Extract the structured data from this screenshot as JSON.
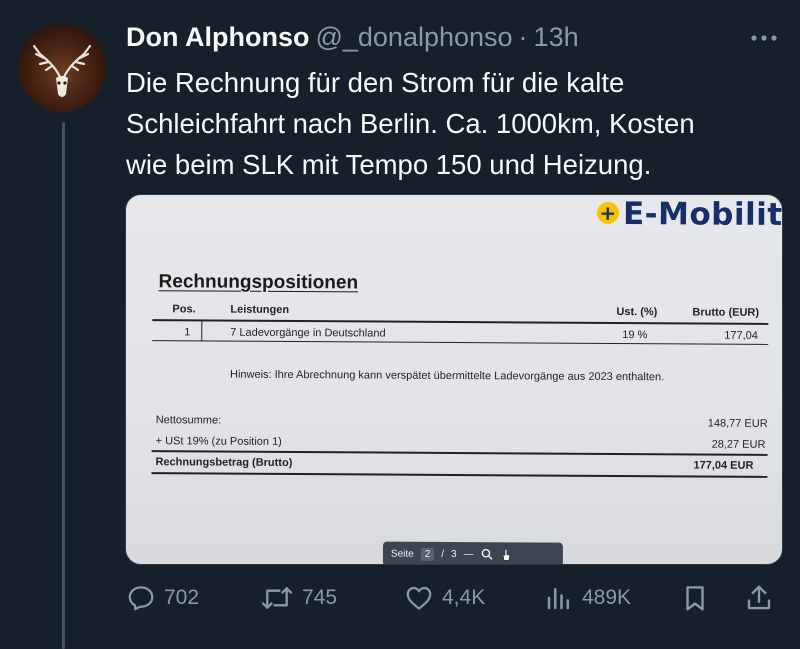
{
  "tweet": {
    "display_name": "Don Alphonso",
    "handle": "@_donalphonso",
    "separator": "·",
    "time": "13h",
    "text": "Die Rechnung für den Strom für die kalte\nSchleichfahrt nach Berlin. Ca. 1000km, Kosten\nwie beim SLK mit Tempo 150 und Heizung."
  },
  "media": {
    "brand": "E-Mobilitat",
    "heading": "Rechnungspositionen",
    "columns": {
      "pos": "Pos.",
      "leistungen": "Leistungen",
      "ust": "Ust. (%)",
      "brutto": "Brutto (EUR)"
    },
    "line_item": {
      "pos": "1",
      "leistung": "7 Ladevorgänge in Deutschland",
      "ust": "19 %",
      "brutto": "177,04"
    },
    "hint": "Hinweis: Ihre Abrechnung kann verspätet übermittelte Ladevorgänge aus 2023 enthalten.",
    "net_label": "Nettosumme:",
    "net_value": "148,77 EUR",
    "tax_label": "+ USt 19% (zu Position 1)",
    "tax_value": "28,27 EUR",
    "total_label": "Rechnungsbetrag (Brutto)",
    "total_value": "177,04 EUR",
    "pdf_toolbar": {
      "page_label": "Seite",
      "current_page": "2",
      "slash": "/",
      "total_pages": "3"
    }
  },
  "actions": {
    "replies": "702",
    "reposts": "745",
    "likes": "4,4K",
    "views": "489K"
  },
  "colors": {
    "background": "#15202b",
    "text_primary": "#f7f9f9",
    "text_secondary": "#8b98a5",
    "thread_line": "#425364"
  },
  "icons": [
    "more-icon",
    "reply-icon",
    "repost-icon",
    "like-icon",
    "views-icon",
    "bookmark-icon",
    "share-icon"
  ]
}
